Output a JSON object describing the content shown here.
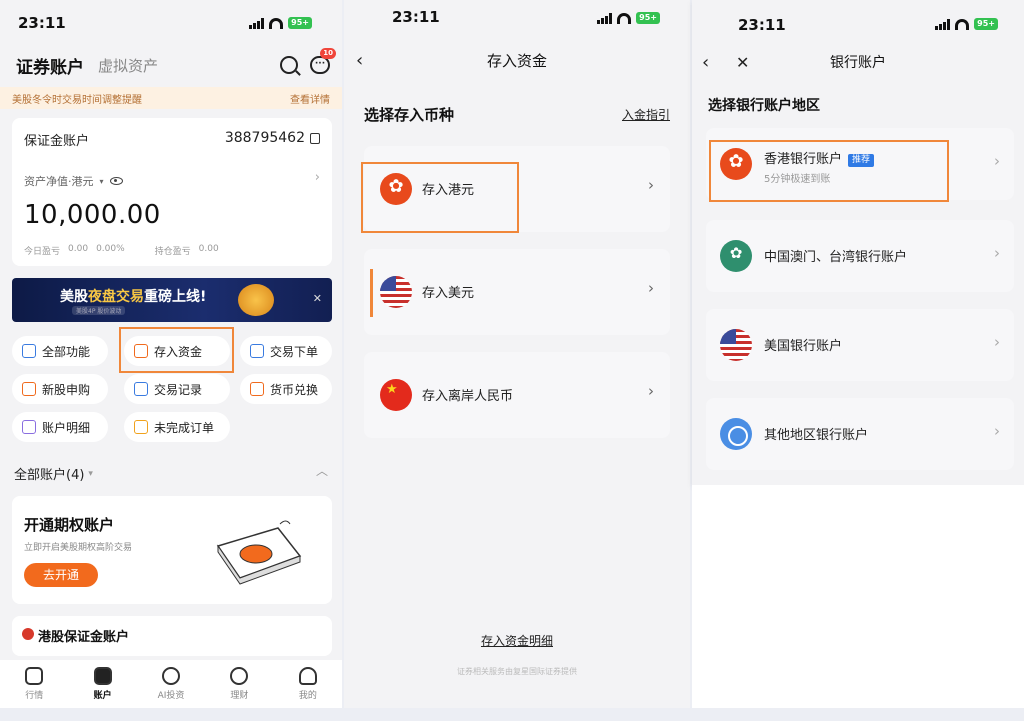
{
  "status": {
    "time": "23:11",
    "battery": "95+"
  },
  "screen1": {
    "header_title": "证券账户",
    "header_tab": "虚拟资产",
    "msg_badge": "10",
    "notice": {
      "text": "美股冬令时交易时间调整提醒",
      "link": "查看详情"
    },
    "account": {
      "title": "保证金账户",
      "number": "388795462",
      "nav_label": "资产净值·港元",
      "value": "10,000.00",
      "today_pnl_label": "今日盈亏",
      "today_pnl": "0.00",
      "today_pct": "0.00%",
      "hold_pnl_label": "持仓盈亏",
      "hold_pnl": "0.00"
    },
    "banner": {
      "text_a": "美股",
      "text_b": "夜盘交易",
      "text_c": "重磅上线!",
      "sub": "美股4P 股价波动"
    },
    "functions": [
      "全部功能",
      "存入资金",
      "交易下单",
      "新股申购",
      "交易记录",
      "货币兑换",
      "账户明细",
      "未完成订单"
    ],
    "all_accounts": "全部账户(4)",
    "options": {
      "title": "开通期权账户",
      "desc": "立即开启美股期权高阶交易",
      "button": "去开通"
    },
    "hk_account": "港股保证金账户",
    "tabs": [
      "行情",
      "账户",
      "AI投资",
      "理财",
      "我的"
    ]
  },
  "screen2": {
    "title": "存入资金",
    "subtitle": "选择存入币种",
    "guide": "入金指引",
    "currencies": [
      "存入港元",
      "存入美元",
      "存入离岸人民币"
    ],
    "detail_link": "存入资金明细",
    "footer": "证券相关服务由复星国际证券提供"
  },
  "screen3": {
    "title": "银行账户",
    "subtitle": "选择银行账户地区",
    "banks": [
      {
        "label": "香港银行账户",
        "tag": "推荐",
        "desc": "5分钟极速到账"
      },
      {
        "label": "中国澳门、台湾银行账户"
      },
      {
        "label": "美国银行账户"
      },
      {
        "label": "其他地区银行账户"
      }
    ]
  },
  "colors": {
    "accent": "#f26a1d",
    "highlight": "#f0873a",
    "tag": "#2f7ae5"
  }
}
